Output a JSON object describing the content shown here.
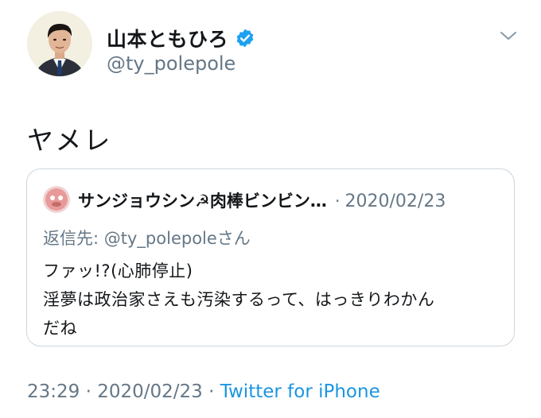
{
  "author": {
    "display_name": "山本ともひろ",
    "handle": "@ty_polepole",
    "verified_icon": "verified-badge-icon"
  },
  "tweet": {
    "text": "ヤメレ"
  },
  "quote": {
    "author_name": "サンジョウシン☭肉棒ビンビン…",
    "separator": "·",
    "date": "2020/02/23",
    "reply_to_label": "返信先: ",
    "reply_to_handle": "@ty_polepoleさん",
    "lines": [
      "ファッ!?(心肺停止)",
      "淫夢は政治家さえも汚染するって、はっきりわかん",
      "だね"
    ]
  },
  "meta": {
    "time": "23:29",
    "separator": "·",
    "date": "2020/02/23",
    "separator2": "·",
    "source": "Twitter for iPhone"
  },
  "colors": {
    "text": "#14171a",
    "secondary": "#657786",
    "link": "#1b95e0",
    "verified": "#1da1f2",
    "border": "#ccd6dd"
  }
}
